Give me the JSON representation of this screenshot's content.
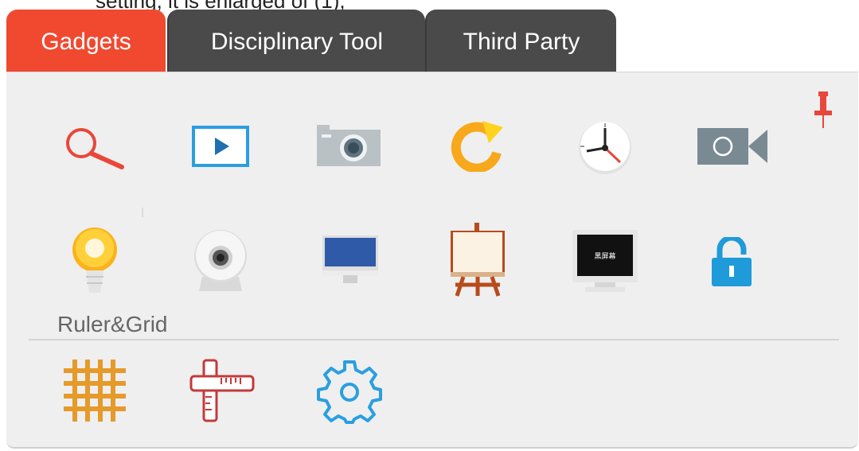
{
  "header": {
    "clipped_text": "setting, it is enlarged of (1),"
  },
  "tabs": [
    {
      "label": "Gadgets",
      "active": true
    },
    {
      "label": "Disciplinary Tool",
      "active": false
    },
    {
      "label": "Third Party",
      "active": false
    }
  ],
  "colors": {
    "active_tab": "#f0492f",
    "inactive_tab": "#4a4a4a",
    "panel_bg": "#efefef"
  },
  "gadgets": {
    "row1": [
      "magnifier-icon",
      "play-screen-icon",
      "camera-icon",
      "refresh-icon",
      "clock-icon",
      "video-camera-icon"
    ],
    "row2": [
      "spotlight-bulb-icon",
      "webcam-icon",
      "monitor-icon",
      "easel-icon",
      "black-screen-icon",
      "lock-icon"
    ]
  },
  "black_screen_text": "黑屏幕",
  "ruler_grid": {
    "label": "Ruler&Grid",
    "items": [
      "grid-icon",
      "ruler-icon",
      "settings-gear-icon"
    ]
  },
  "pin": "pin-icon"
}
